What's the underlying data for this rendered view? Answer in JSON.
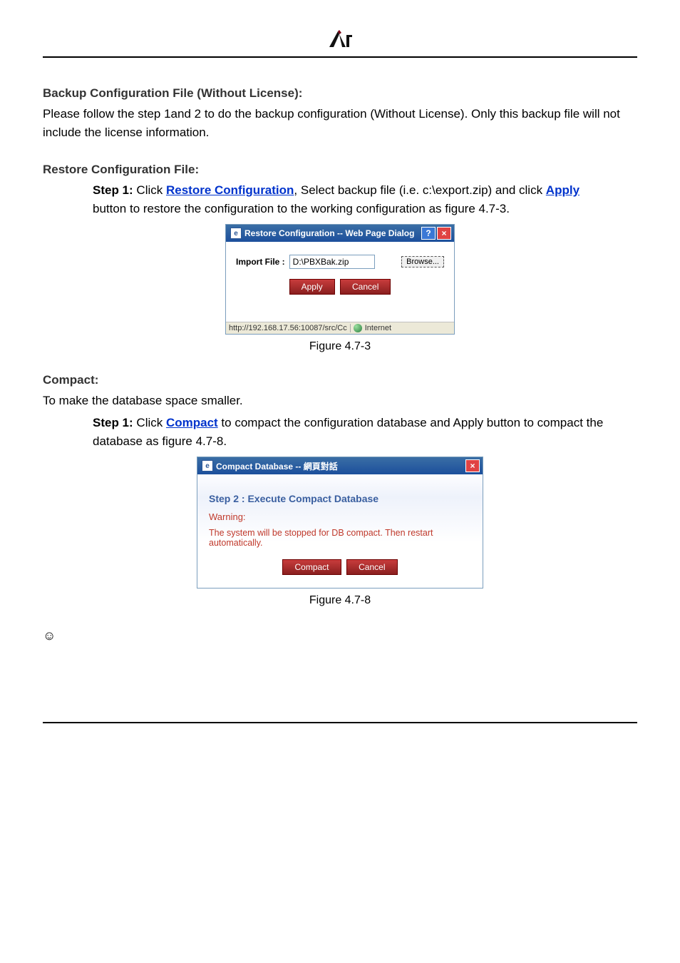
{
  "section1": {
    "heading": "Backup Configuration File (Without License):",
    "p1": "Please follow the step 1and 2 to do the backup configuration (Without License). Only this backup file will not include the license information."
  },
  "section2": {
    "heading": "Restore Configuration File:",
    "step_label": "Step 1:",
    "text_a": " Click ",
    "link": "Restore Configuration",
    "text_b": ", Select backup file (i.e. c:\\export.zip) and click ",
    "apply_word": "Apply",
    "text_c": " button to restore the configuration to the working configuration as figure 4.7-3."
  },
  "dialog1": {
    "title": "Restore Configuration -- Web Page Dialog",
    "import_label": "Import File :",
    "import_value": "D:\\PBXBak.zip",
    "browse": "Browse...",
    "apply": "Apply",
    "cancel": "Cancel",
    "status_left": "http://192.168.17.56:10087/src/Cc",
    "status_right": "Internet"
  },
  "fig1_caption": "Figure 4.7-3",
  "section3": {
    "heading": "Compact:",
    "intro": "To make the database space smaller.",
    "step_label": "Step 1:",
    "text_a": " Click ",
    "link": "Compact",
    "text_b": " to compact the configuration database and Apply button to compact the database as figure 4.7-8."
  },
  "dialog2": {
    "title": "Compact Database -- 網頁對話",
    "step_title": "Step 2 : Execute Compact Database",
    "warning_label": "Warning:",
    "warning_text": "The system will be stopped for DB compact. Then restart automatically.",
    "compact": "Compact",
    "cancel": "Cancel"
  },
  "fig2_caption": "Figure 4.7-8",
  "smiley": "☺",
  "footer": " "
}
